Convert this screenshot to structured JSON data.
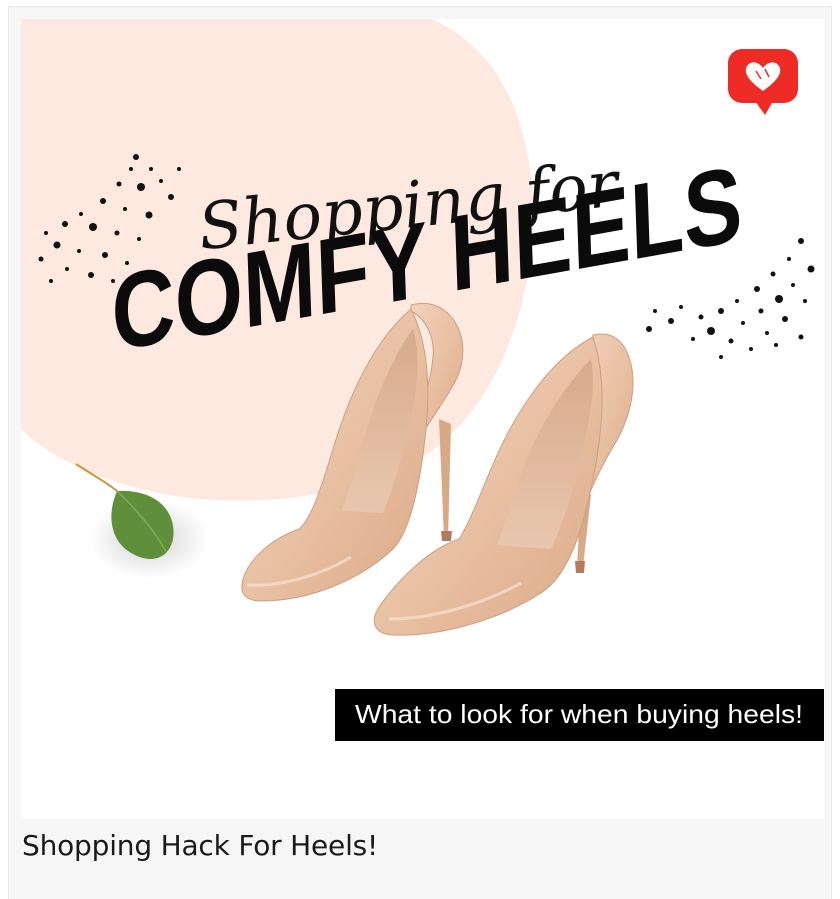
{
  "post": {
    "graphic": {
      "headline_script": "Shopping for",
      "headline_bold": "COMFY HEELS",
      "banner_text": "What to look for when buying heels!",
      "badge_icon": "heart-speech-bubble-icon",
      "colors": {
        "blob": "#fde9df",
        "text": "#0b0b0b",
        "badge": "#ee2b24",
        "shoe": "#e9c3a6",
        "leaf": "#5f8f3a"
      }
    },
    "caption": "Shopping Hack For Heels!"
  }
}
